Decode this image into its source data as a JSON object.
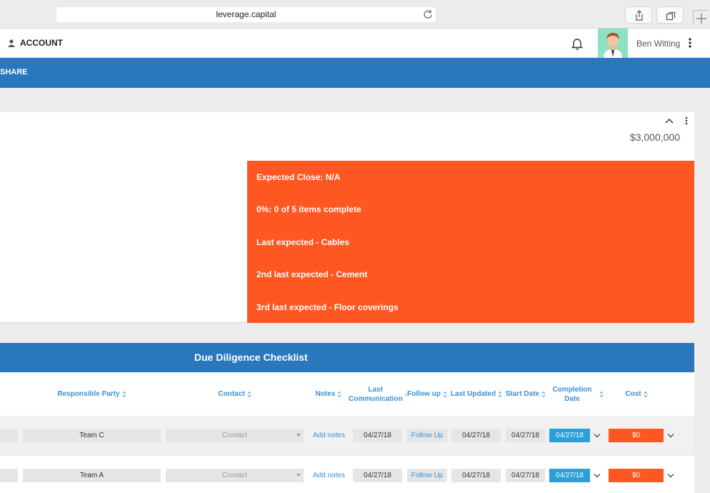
{
  "browser": {
    "url": "leverage.capital"
  },
  "header": {
    "account_label": "ACCOUNT",
    "user_name": "Ben Witting"
  },
  "nav": {
    "item": "SHARE"
  },
  "card": {
    "amount": "$3,000,000"
  },
  "summary": {
    "lines": [
      "Expected Close: N/A",
      "0%: 0 of 5 items complete",
      "Last expected - Cables",
      "2nd last expected - Cement",
      "3rd last expected - Floor coverings"
    ],
    "bg_color": "#fe5722"
  },
  "checklist": {
    "title": "Due Diligence Checklist",
    "columns": {
      "responsible_party": "Responsible Party",
      "contact": "Contact",
      "notes": "Notes",
      "last_comm_1": "Last",
      "last_comm_2": "Communication",
      "follow_up": "Follow up",
      "last_updated": "Last Updated",
      "start_date": "Start Date",
      "completion_1": "Completion",
      "completion_2": "Date",
      "cost": "Cost"
    },
    "rows": [
      {
        "team": "Team C",
        "contact": "Contact",
        "notes": "Add notes",
        "last_comm": "04/27/18",
        "follow_up": "Follow Up",
        "last_updated": "04/27/18",
        "start_date": "04/27/18",
        "completion": "04/27/18",
        "cost": "$0"
      },
      {
        "team": "Team A",
        "contact": "Contact",
        "notes": "Add notes",
        "last_comm": "04/27/18",
        "follow_up": "Follow Up",
        "last_updated": "04/27/18",
        "start_date": "04/27/18",
        "completion": "04/27/18",
        "cost": "$0"
      }
    ]
  },
  "colors": {
    "primary_blue": "#2a77bd",
    "accent_orange": "#fe5722",
    "link_blue": "#3a8fd6"
  }
}
